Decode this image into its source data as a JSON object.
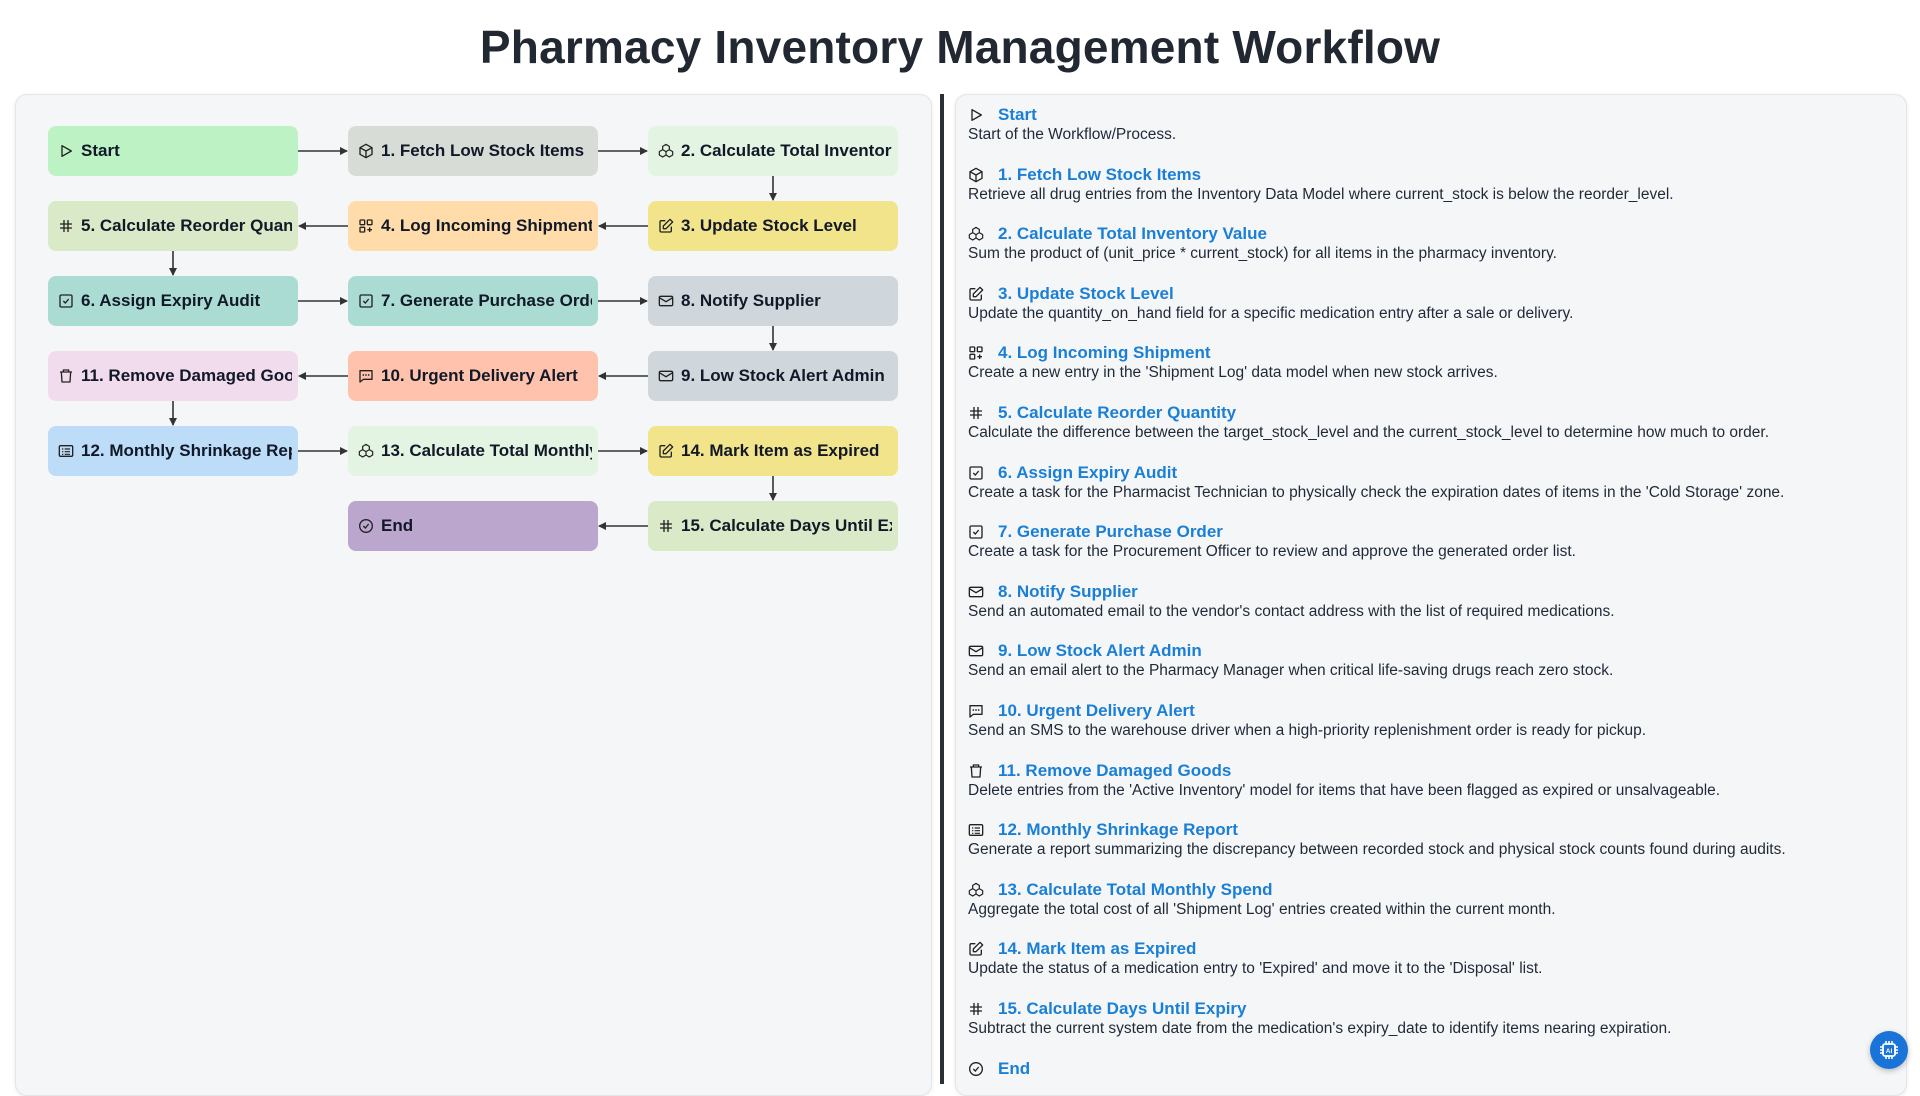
{
  "page": {
    "title": "Pharmacy Inventory Management Workflow"
  },
  "nodes": [
    {
      "id": "start",
      "label": "Start",
      "icon": "play-icon",
      "color": "#bdf2c4"
    },
    {
      "id": "s1",
      "label": "1. Fetch Low Stock Items",
      "icon": "box-icon",
      "color": "#d7ddd6"
    },
    {
      "id": "s2",
      "label": "2. Calculate Total Inventory Value",
      "icon": "cubes-icon",
      "color": "#e4f4e2"
    },
    {
      "id": "s3",
      "label": "3. Update Stock Level",
      "icon": "edit-icon",
      "color": "#f2e48a"
    },
    {
      "id": "s4",
      "label": "4. Log Incoming Shipment",
      "icon": "grid-plus-icon",
      "color": "#ffdcaa"
    },
    {
      "id": "s5",
      "label": "5. Calculate Reorder Quantity",
      "icon": "hash-icon",
      "color": "#dae9c7"
    },
    {
      "id": "s6",
      "label": "6. Assign Expiry Audit",
      "icon": "checkbox-icon",
      "color": "#aadcd4"
    },
    {
      "id": "s7",
      "label": "7. Generate Purchase Order",
      "icon": "checkbox-icon",
      "color": "#aadcd4"
    },
    {
      "id": "s8",
      "label": "8. Notify Supplier",
      "icon": "mail-icon",
      "color": "#cfd7dc"
    },
    {
      "id": "s9",
      "label": "9. Low Stock Alert Admin",
      "icon": "mail-icon",
      "color": "#cfd7dc"
    },
    {
      "id": "s10",
      "label": "10. Urgent Delivery Alert",
      "icon": "message-icon",
      "color": "#ffc3ad"
    },
    {
      "id": "s11",
      "label": "11. Remove Damaged Goods",
      "icon": "trash-icon",
      "color": "#f1dcee"
    },
    {
      "id": "s12",
      "label": "12. Monthly Shrinkage Report",
      "icon": "report-icon",
      "color": "#bcdcf7"
    },
    {
      "id": "s13",
      "label": "13. Calculate Total Monthly Spend",
      "icon": "cubes-icon",
      "color": "#e4f4e2"
    },
    {
      "id": "s14",
      "label": "14. Mark Item as Expired",
      "icon": "edit-icon",
      "color": "#f2e48a"
    },
    {
      "id": "s15",
      "label": "15. Calculate Days Until Expiry",
      "icon": "hash-icon",
      "color": "#dae9c7"
    },
    {
      "id": "end",
      "label": "End",
      "icon": "check-circle-icon",
      "color": "#bba6ce"
    }
  ],
  "steps": [
    {
      "title": "Start",
      "icon": "play-icon",
      "desc": "Start of the Workflow/Process."
    },
    {
      "title": "1. Fetch Low Stock Items",
      "icon": "box-icon",
      "desc": "Retrieve all drug entries from the Inventory Data Model where current_stock is below the reorder_level."
    },
    {
      "title": "2. Calculate Total Inventory Value",
      "icon": "cubes-icon",
      "desc": "Sum the product of (unit_price * current_stock) for all items in the pharmacy inventory."
    },
    {
      "title": "3. Update Stock Level",
      "icon": "edit-icon",
      "desc": "Update the quantity_on_hand field for a specific medication entry after a sale or delivery."
    },
    {
      "title": "4. Log Incoming Shipment",
      "icon": "grid-plus-icon",
      "desc": "Create a new entry in the 'Shipment Log' data model when new stock arrives."
    },
    {
      "title": "5. Calculate Reorder Quantity",
      "icon": "hash-icon",
      "desc": "Calculate the difference between the target_stock_level and the current_stock_level to determine how much to order."
    },
    {
      "title": "6. Assign Expiry Audit",
      "icon": "checkbox-icon",
      "desc": "Create a task for the Pharmacist Technician to physically check the expiration dates of items in the 'Cold Storage' zone."
    },
    {
      "title": "7. Generate Purchase Order",
      "icon": "checkbox-icon",
      "desc": "Create a task for the Procurement Officer to review and approve the generated order list."
    },
    {
      "title": "8. Notify Supplier",
      "icon": "mail-icon",
      "desc": "Send an automated email to the vendor's contact address with the list of required medications."
    },
    {
      "title": "9. Low Stock Alert Admin",
      "icon": "mail-icon",
      "desc": "Send an email alert to the Pharmacy Manager when critical life-saving drugs reach zero stock."
    },
    {
      "title": "10. Urgent Delivery Alert",
      "icon": "message-icon",
      "desc": "Send an SMS to the warehouse driver when a high-priority replenishment order is ready for pickup."
    },
    {
      "title": "11. Remove Damaged Goods",
      "icon": "trash-icon",
      "desc": "Delete entries from the 'Active Inventory' model for items that have been flagged as expired or unsalvageable."
    },
    {
      "title": "12. Monthly Shrinkage Report",
      "icon": "report-icon",
      "desc": "Generate a report summarizing the discrepancy between recorded stock and physical stock counts found during audits."
    },
    {
      "title": "13. Calculate Total Monthly Spend",
      "icon": "cubes-icon",
      "desc": "Aggregate the total cost of all 'Shipment Log' entries created within the current month."
    },
    {
      "title": "14. Mark Item as Expired",
      "icon": "edit-icon",
      "desc": "Update the status of a medication entry to 'Expired' and move it to the 'Disposal' list."
    },
    {
      "title": "15. Calculate Days Until Expiry",
      "icon": "hash-icon",
      "desc": "Subtract the current system date from the medication's expiry_date to identify items nearing expiration."
    },
    {
      "title": "End",
      "icon": "check-circle-icon",
      "desc": ""
    }
  ],
  "fab": {
    "icon": "ai-chip-icon"
  }
}
